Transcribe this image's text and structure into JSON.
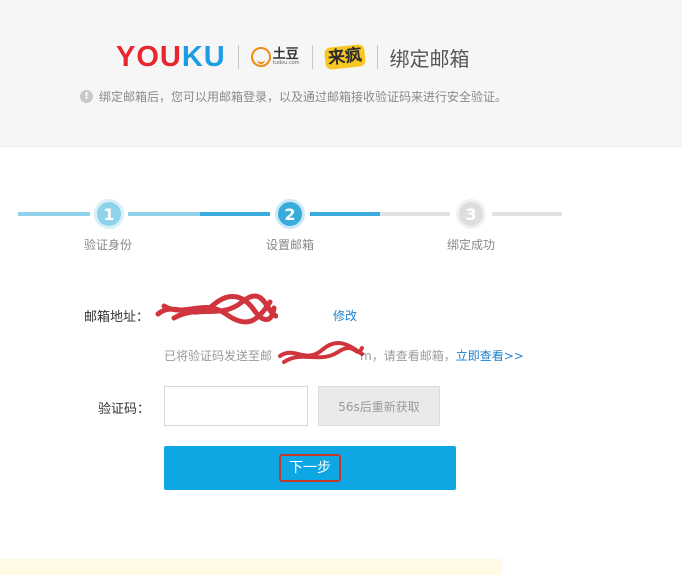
{
  "header": {
    "brand_youku_1": "YOU",
    "brand_youku_2": "KU",
    "tudou_cn": "土豆",
    "tudou_en": "tudou.com",
    "laifeng": "来疯",
    "title": "绑定邮箱",
    "notice": "绑定邮箱后，您可以用邮箱登录，以及通过邮箱接收验证码来进行安全验证。"
  },
  "steps": [
    {
      "number": "1",
      "label": "验证身份"
    },
    {
      "number": "2",
      "label": "设置邮箱"
    },
    {
      "number": "3",
      "label": "绑定成功"
    }
  ],
  "form": {
    "email_label": "邮箱地址：",
    "modify_link": "修改",
    "hint_prefix": "已将验证码发送至邮",
    "hint_suffix": "m，请查看邮箱，",
    "hint_link": "立即查看>>",
    "code_label": "验证码：",
    "code_value": "",
    "code_placeholder": "",
    "resend_button": "56s后重新获取",
    "next_button": "下一步"
  },
  "colors": {
    "accent": "#0ea6e3",
    "step_done": "#7fd0eb",
    "step_current": "#2fa9dc",
    "step_pending": "#dddddd",
    "youku_red": "#e8262f",
    "youku_blue": "#1f9de4"
  }
}
